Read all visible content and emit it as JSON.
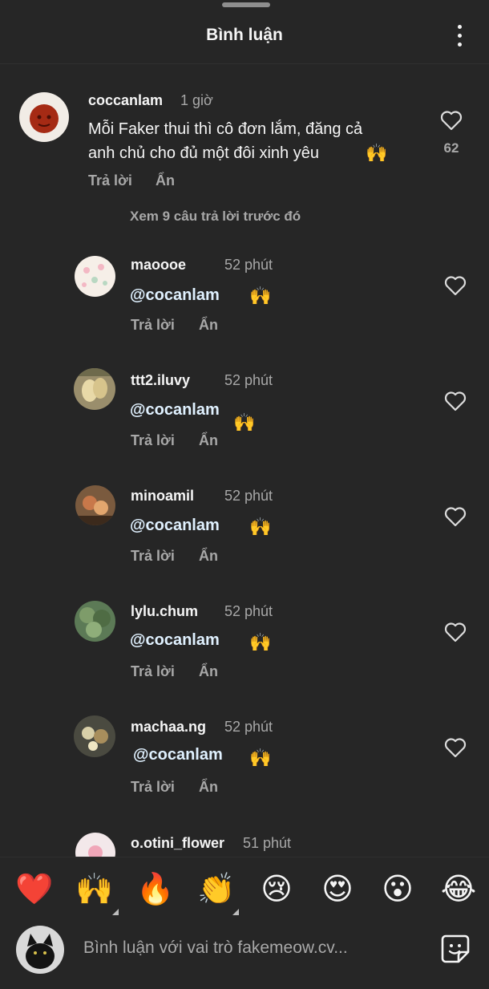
{
  "header": {
    "title": "Bình luận"
  },
  "main_comment": {
    "username": "coccanlam",
    "time": "1 giờ",
    "text_line1": "Mỗi Faker thui thì cô đơn lắm, đăng cả",
    "text_line2": "anh chủ cho đủ một đôi xinh yêu",
    "emoji": "🙌",
    "likes": "62",
    "reply_label": "Trả lời",
    "hide_label": "Ẩn"
  },
  "view_more": "Xem 9 câu trả lời trước đó",
  "replies": [
    {
      "username": "maoooe",
      "time": "52 phút",
      "mention": "@cocanlam",
      "emoji": "🙌",
      "reply_label": "Trả lời",
      "hide_label": "Ẩn"
    },
    {
      "username": "ttt2.iluvy",
      "time": "52 phút",
      "mention": "@cocanlam",
      "emoji": "🙌",
      "reply_label": "Trả lời",
      "hide_label": "Ẩn"
    },
    {
      "username": "minoamil",
      "time": "52 phút",
      "mention": "@cocanlam",
      "emoji": "🙌",
      "reply_label": "Trả lời",
      "hide_label": "Ẩn"
    },
    {
      "username": "lylu.chum",
      "time": "52 phút",
      "mention": "@cocanlam",
      "emoji": "🙌",
      "reply_label": "Trả lời",
      "hide_label": "Ẩn"
    },
    {
      "username": "machaa.ng",
      "time": "52 phút",
      "mention": "@cocanlam",
      "emoji": "🙌",
      "reply_label": "Trả lời",
      "hide_label": "Ẩn"
    },
    {
      "username": "o.otini_flower",
      "time": "51 phút"
    }
  ],
  "reactions": [
    "❤️",
    "🙌",
    "🔥",
    "👏",
    "😢",
    "😍",
    "😮",
    "😂"
  ],
  "input": {
    "placeholder": "Bình luận với vai trò fakemeow.cv..."
  },
  "icons": {
    "heart": "heart-icon",
    "more": "more-vertical-icon",
    "sticker": "sticker-icon"
  },
  "colors": {
    "background": "#262626",
    "mention": "#e0f1ff",
    "muted": "#a8a8a8"
  }
}
